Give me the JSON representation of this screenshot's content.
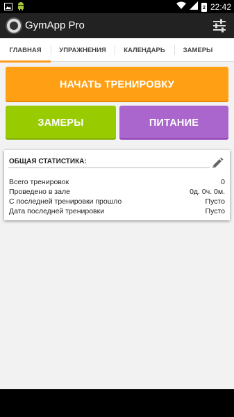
{
  "status_bar": {
    "time": "22:42",
    "battery_level": "2",
    "icons": [
      "image-icon",
      "android-icon",
      "wifi-icon",
      "signal-icon",
      "battery-icon"
    ]
  },
  "app": {
    "title": "GymApp Pro"
  },
  "tabs": [
    {
      "label": "ГЛАВНАЯ",
      "active": true
    },
    {
      "label": "УПРАЖНЕНИЯ",
      "active": false
    },
    {
      "label": "КАЛЕНДАРЬ",
      "active": false
    },
    {
      "label": "ЗАМЕРЫ",
      "active": false
    }
  ],
  "buttons": {
    "start_workout": "НАЧАТЬ ТРЕНИРОВКУ",
    "measurements": "ЗАМЕРЫ",
    "nutrition": "ПИТАНИЕ"
  },
  "stats": {
    "title": "ОБЩАЯ СТАТИСТИКА:",
    "rows": [
      {
        "label": "Всего тренировок",
        "value": "0"
      },
      {
        "label": "Проведено в зале",
        "value": "0д. 0ч. 0м."
      },
      {
        "label": "С последней тренировки прошло",
        "value": "Пусто"
      },
      {
        "label": "Дата последней тренировки",
        "value": "Пусто"
      }
    ]
  },
  "colors": {
    "accent": "#ff9a1f",
    "start_button": "#ffa014",
    "measure_button": "#99cc00",
    "nutrition_button": "#aa66cc",
    "action_bar": "#222222"
  }
}
